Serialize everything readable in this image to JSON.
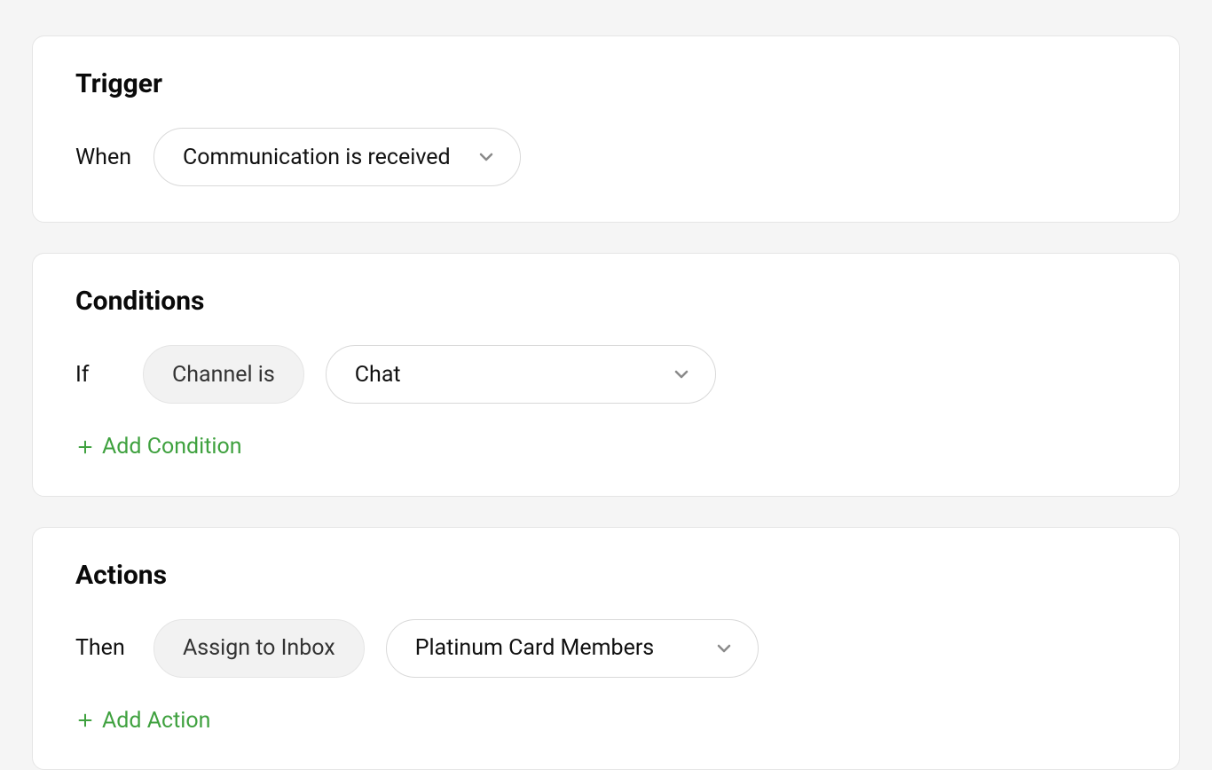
{
  "trigger": {
    "title": "Trigger",
    "label": "When",
    "dropdown_value": "Communication is received"
  },
  "conditions": {
    "title": "Conditions",
    "label": "If",
    "type_pill": "Channel is",
    "dropdown_value": "Chat",
    "add_label": "Add Condition"
  },
  "actions": {
    "title": "Actions",
    "label": "Then",
    "type_pill": "Assign to Inbox",
    "dropdown_value": "Platinum Card Members",
    "add_label": "Add Action"
  }
}
